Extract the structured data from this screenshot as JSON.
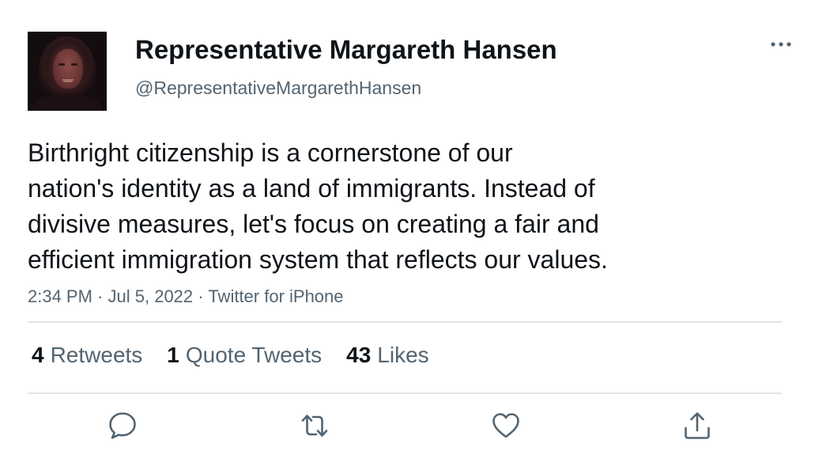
{
  "tweet": {
    "author_name": "Representative Margareth Hansen",
    "author_handle": "@RepresentativeMargarethHansen",
    "text": "Birthright citizenship is a cornerstone of our\nnation's identity as a land of immigrants. Instead of\ndivisive measures, let's focus on creating a fair and\nefficient immigration system that reflects our values.",
    "time": "2:34 PM",
    "date": "Jul 5, 2022",
    "source": "Twitter for iPhone",
    "separator": "·"
  },
  "stats": {
    "retweets_count": "4",
    "retweets_label": "Retweets",
    "quotes_count": "1",
    "quotes_label": "Quote Tweets",
    "likes_count": "43",
    "likes_label": "Likes"
  },
  "icons": {
    "more": "more-horizontal-icon",
    "reply": "reply-bubble-icon",
    "retweet": "retweet-icon",
    "like": "heart-icon",
    "share": "share-upload-icon"
  },
  "colors": {
    "primary_text": "#0f1419",
    "secondary_text": "#536471",
    "divider": "#e1e5e8",
    "icon": "#536471"
  }
}
